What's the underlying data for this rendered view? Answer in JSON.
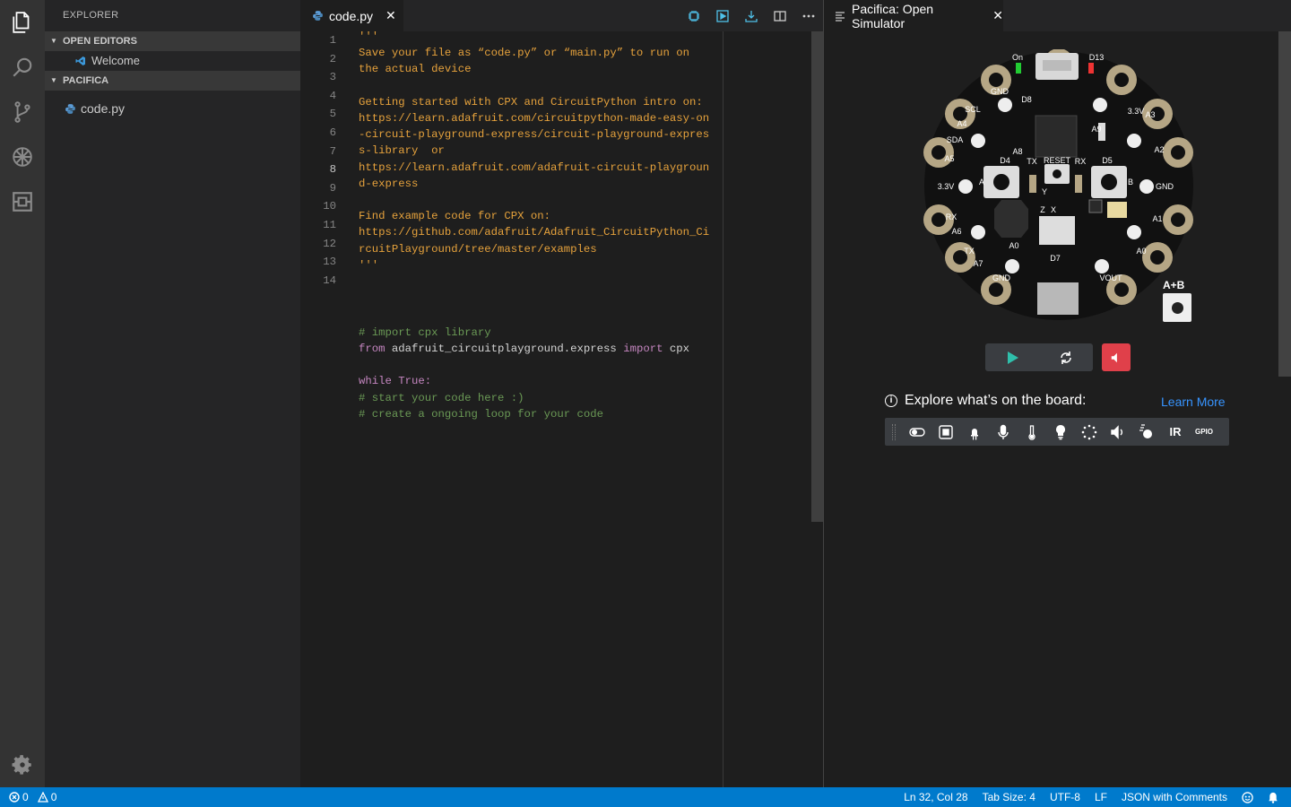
{
  "sidebar": {
    "title": "EXPLORER",
    "open_editors": {
      "label": "OPEN EDITORS",
      "items": [
        {
          "label": "Welcome"
        }
      ]
    },
    "workspace": {
      "label": "PACIFICA",
      "items": [
        {
          "label": "code.py"
        }
      ]
    }
  },
  "editor": {
    "tab_label": "code.py",
    "toolbar_icons": [
      "device-icon",
      "run-icon",
      "deploy-icon",
      "split-editor-icon",
      "more-icon"
    ],
    "line_numbers": [
      "1",
      "2",
      "3",
      "4",
      "5",
      "6",
      "7",
      "8",
      "9",
      "10",
      "11",
      "12",
      "13",
      "14"
    ],
    "active_line": "8",
    "lines": [
      "'''",
      "Save your file as “code.py” or “main.py” to run on",
      "the actual device",
      "",
      "Getting started with CPX and CircuitPython intro on:",
      "https://learn.adafruit.com/circuitpython-made-easy-on",
      "-circuit-playground-express/circuit-playground-expres",
      "s-library  or",
      "https://learn.adafruit.com/adafruit-circuit-playgroun",
      "d-express",
      "",
      "Find example code for CPX on:",
      "https://github.com/adafruit/Adafruit_CircuitPython_Ci",
      "rcuitPlayground/tree/master/examples",
      "'''"
    ],
    "code": {
      "comment1": "# import cpx library",
      "from_kw": "from",
      "module": " adafruit_circuitplayground.express ",
      "import_kw": "import",
      "import_name": " cpx",
      "while_line": "while True:",
      "comment2": "# start your code here :)",
      "comment3": "# create a ongoing loop for your code"
    }
  },
  "simulator": {
    "tab_label": "Pacifica: Open Simulator",
    "ab_label": "A+B",
    "explore_title": "Explore what’s on the board:",
    "learn_more": "Learn More",
    "features": [
      "switch-icon",
      "button-icon",
      "led-icon",
      "microphone-icon",
      "thermometer-icon",
      "light-bulb-icon",
      "neopixel-ring-icon",
      "speaker-icon",
      "motion-icon"
    ],
    "feature_text": {
      "ir": "IR",
      "gpio": "GPIO"
    },
    "board_labels": {
      "on": "On",
      "d13": "D13",
      "gnd": "GND",
      "d8": "D8",
      "scl": "SCL",
      "a4": "A4",
      "sda": "SDA",
      "a5": "A5",
      "a9": "A9",
      "a8": "A8",
      "d4": "D4",
      "tx": "TX",
      "reset": "RESET",
      "rx": "RX",
      "d5": "D5",
      "a": "A",
      "b": "B",
      "v33": "3.3V",
      "a3": "A3",
      "a2": "A2",
      "a1": "A1",
      "a0": "A0",
      "a6": "A6",
      "a7": "A7",
      "d7": "D7",
      "vout": "VOUT",
      "x": "X",
      "y": "Y",
      "z": "Z"
    }
  },
  "status": {
    "errors": "0",
    "warnings": "0",
    "position": "Ln 32, Col 28",
    "tab_size": "Tab Size: 4",
    "encoding": "UTF-8",
    "eol": "LF",
    "language": "JSON with Comments"
  }
}
